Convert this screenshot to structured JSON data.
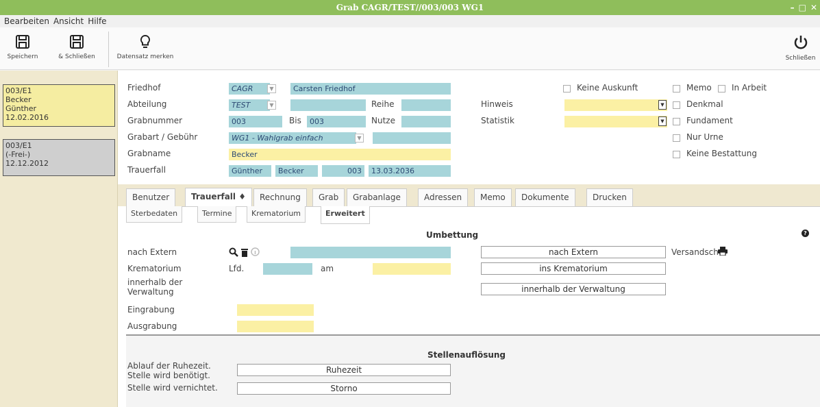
{
  "window": {
    "title": "Grab CAGR/TEST//003/003 WG1"
  },
  "menu": [
    "Bearbeiten",
    "Ansicht",
    "Hilfe"
  ],
  "toolbar": {
    "save_label": "Speichern",
    "save_close_label": "& Schließen",
    "mark_label": "Datensatz merken",
    "close_label": "Schließen"
  },
  "sidebar": {
    "cards": [
      {
        "lines": [
          "003/E1",
          "Becker",
          "Günther",
          "12.02.2016"
        ],
        "color": "#f5eda1"
      },
      {
        "lines": [
          "003/E1",
          "(-Frei-)",
          "12.12.2012"
        ],
        "color": "#cfcfcf"
      }
    ]
  },
  "form": {
    "friedhof": {
      "label": "Friedhof",
      "code": "CAGR",
      "name": "Carsten Friedhof"
    },
    "abteilung": {
      "label": "Abteilung",
      "code": "TEST",
      "name": "",
      "reihe_label": "Reihe",
      "reihe": ""
    },
    "grabnummer": {
      "label": "Grabnummer",
      "von": "003",
      "bis_label": "Bis",
      "bis": "003",
      "nutze_label": "Nutze",
      "nutze": ""
    },
    "grabart": {
      "label": "Grabart / Gebühr",
      "value": "WG1 - Wahlgrab einfach",
      "extra": ""
    },
    "grabname": {
      "label": "Grabname",
      "value": "Becker"
    },
    "trauerfall": {
      "label": "Trauerfall",
      "vorname": "Günther",
      "nachname": "Becker",
      "nr": "003",
      "datum": "13.03.2036"
    },
    "hinweis": {
      "label": "Hinweis",
      "value": ""
    },
    "statistik": {
      "label": "Statistik",
      "value": ""
    },
    "checks": {
      "keine_auskunft": "Keine Auskunft",
      "memo": "Memo",
      "in_arbeit": "In Arbeit",
      "denkmal": "Denkmal",
      "fundament": "Fundament",
      "nur_urne": "Nur Urne",
      "keine_bestattung": "Keine Bestattung"
    }
  },
  "tabs": [
    {
      "label": "Benutzer"
    },
    {
      "label": "Trauerfall ♦"
    },
    {
      "label": "Rechnung"
    },
    {
      "label": "Grab"
    },
    {
      "label": "Grabanlage"
    },
    {
      "label": "Adressen"
    },
    {
      "label": "Memo"
    },
    {
      "label": "Dokumente"
    },
    {
      "label": "Drucken"
    }
  ],
  "subtabs": [
    {
      "label": "Sterbedaten"
    },
    {
      "label": "Termine"
    },
    {
      "label": "Krematorium"
    },
    {
      "label": "Erweitert"
    }
  ],
  "umbettung": {
    "title": "Umbettung",
    "nach_extern_label": "nach Extern",
    "nach_extern_value": "",
    "krematorium_label": "Krematorium",
    "lfd_label": "Lfd.",
    "lfd_value": "",
    "am_label": "am",
    "am_value": "",
    "innerhalb_label_1": "innerhalb der",
    "innerhalb_label_2": "Verwaltung",
    "eingrabung_label": "Eingrabung",
    "ausgrabung_label": "Ausgrabung",
    "btn_nach_extern": "nach Extern",
    "btn_krematorium": "ins Krematorium",
    "btn_innerhalb": "innerhalb der Verwaltung",
    "versand_label": "Versandsch"
  },
  "stellenaufloesung": {
    "title": "Stellenauflösung",
    "ablauf_label_1": "Ablauf der Ruhezeit.",
    "ablauf_label_2": "Stelle wird benötigt.",
    "vernichtet_label": "Stelle wird vernichtet.",
    "btn_ruhezeit": "Ruhezeit",
    "btn_storno": "Storno"
  }
}
